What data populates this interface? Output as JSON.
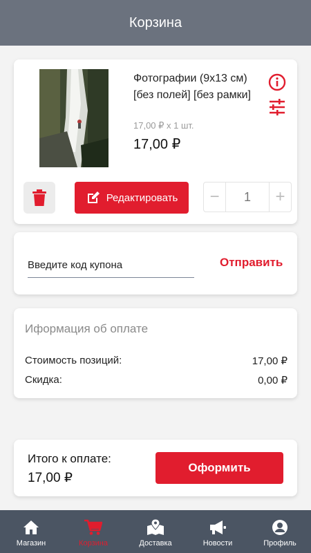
{
  "header": {
    "title": "Корзина"
  },
  "cart_item": {
    "title": "Фотографии (9х13 см) [без полей] [без рамки]",
    "unit_price_line": "17,00 ₽ x 1 шт.",
    "price": "17,00 ₽",
    "image": "waterfall-photo",
    "edit_label": "Редактировать",
    "quantity": "1",
    "minus": "−",
    "plus": "+"
  },
  "coupon": {
    "placeholder": "Введите код купона",
    "value": "",
    "submit_label": "Отправить"
  },
  "payment": {
    "title": "Иформация об оплате",
    "rows": [
      {
        "label": "Стоимость позиций:",
        "value": "17,00 ₽"
      },
      {
        "label": "Скидка:",
        "value": "0,00 ₽"
      }
    ]
  },
  "total": {
    "label": "Итого к оплате:",
    "value": "17,00 ₽",
    "checkout_label": "Оформить"
  },
  "nav": {
    "items": [
      {
        "label": "Магазин",
        "icon": "home-icon",
        "active": false
      },
      {
        "label": "Корзина",
        "icon": "cart-icon",
        "active": true
      },
      {
        "label": "Доставка",
        "icon": "map-icon",
        "active": false
      },
      {
        "label": "Новости",
        "icon": "megaphone-icon",
        "active": false
      },
      {
        "label": "Профиль",
        "icon": "user-icon",
        "active": false
      }
    ]
  },
  "colors": {
    "accent": "#e11d2e",
    "header": "#6b727e",
    "nav_bg": "#4b5563"
  }
}
